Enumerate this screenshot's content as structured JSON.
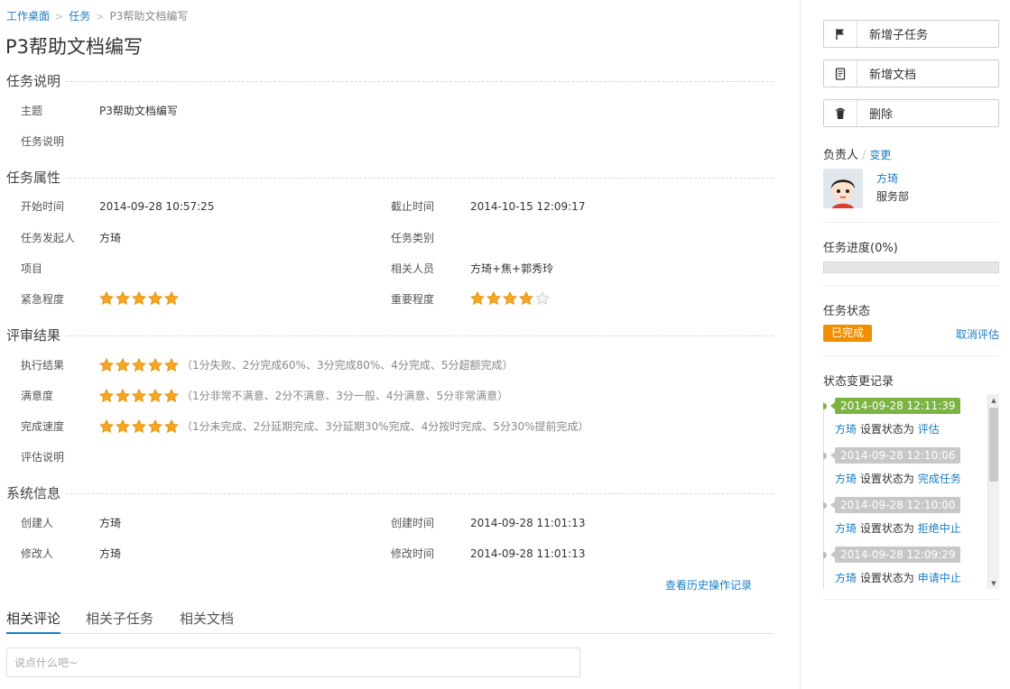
{
  "breadcrumb": {
    "items": [
      "工作桌面",
      "任务"
    ],
    "current": "P3帮助文档编写"
  },
  "title": "P3帮助文档编写",
  "sections": {
    "description": {
      "title": "任务说明",
      "subject_label": "主题",
      "subject_value": "P3帮助文档编写",
      "desc_label": "任务说明",
      "desc_value": ""
    },
    "attributes": {
      "title": "任务属性",
      "start_label": "开始时间",
      "start_value": "2014-09-28 10:57:25",
      "deadline_label": "截止时间",
      "deadline_value": "2014-10-15 12:09:17",
      "initiator_label": "任务发起人",
      "initiator_value": "方琦",
      "category_label": "任务类别",
      "category_value": "",
      "project_label": "项目",
      "project_value": "",
      "related_label": "相关人员",
      "related_value": "方琦+焦+郭秀玲",
      "urgency_label": "紧急程度",
      "urgency_rating": 5,
      "importance_label": "重要程度",
      "importance_rating": 4,
      "rating_max": 5
    },
    "review": {
      "title": "评审结果",
      "exec_label": "执行结果",
      "exec_rating": 5,
      "exec_hint": "（1分失败、2分完成60%、3分完成80%、4分完成、5分超额完成）",
      "satisfaction_label": "满意度",
      "satisfaction_rating": 5,
      "satisfaction_hint": "（1分非常不满意、2分不满意、3分一般、4分满意、5分非常满意）",
      "speed_label": "完成速度",
      "speed_rating": 5,
      "speed_hint": "（1分未完成、2分延期完成、3分延期30%完成、4分按时完成、5分30%提前完成）",
      "eval_label": "评估说明",
      "eval_value": ""
    },
    "system": {
      "title": "系统信息",
      "creator_label": "创建人",
      "creator_value": "方琦",
      "created_label": "创建时间",
      "created_value": "2014-09-28 11:01:13",
      "modifier_label": "修改人",
      "modifier_value": "方琦",
      "modified_label": "修改时间",
      "modified_value": "2014-09-28 11:01:13"
    }
  },
  "history_link": "查看历史操作记录",
  "tabs": [
    "相关评论",
    "相关子任务",
    "相关文档"
  ],
  "comment": {
    "placeholder": "说点什么吧~"
  },
  "actions": {
    "add_subtask": "新增子任务",
    "add_doc": "新增文档",
    "delete": "删除"
  },
  "owner": {
    "label": "负责人",
    "change": "变更",
    "name": "方琦",
    "dept": "服务部"
  },
  "progress": {
    "label": "任务进度(0%)",
    "value": 0
  },
  "status": {
    "label": "任务状态",
    "badge": "已完成",
    "cancel": "取消评估",
    "badge_color": "#f08f00"
  },
  "log": {
    "label": "状态变更记录",
    "set_text": "设置状态为",
    "entries": [
      {
        "time": "2014-09-28 12:11:39",
        "who": "方琦",
        "status": "评估",
        "highlight": true
      },
      {
        "time": "2014-09-28 12:10:06",
        "who": "方琦",
        "status": "完成任务",
        "highlight": false
      },
      {
        "time": "2014-09-28 12:10:00",
        "who": "方琦",
        "status": "拒绝中止",
        "highlight": false
      },
      {
        "time": "2014-09-28 12:09:29",
        "who": "方琦",
        "status": "申请中止",
        "highlight": false
      }
    ]
  },
  "colors": {
    "link": "#1a7dc4",
    "star": "#f5a623",
    "highlight": "#7cb342"
  }
}
